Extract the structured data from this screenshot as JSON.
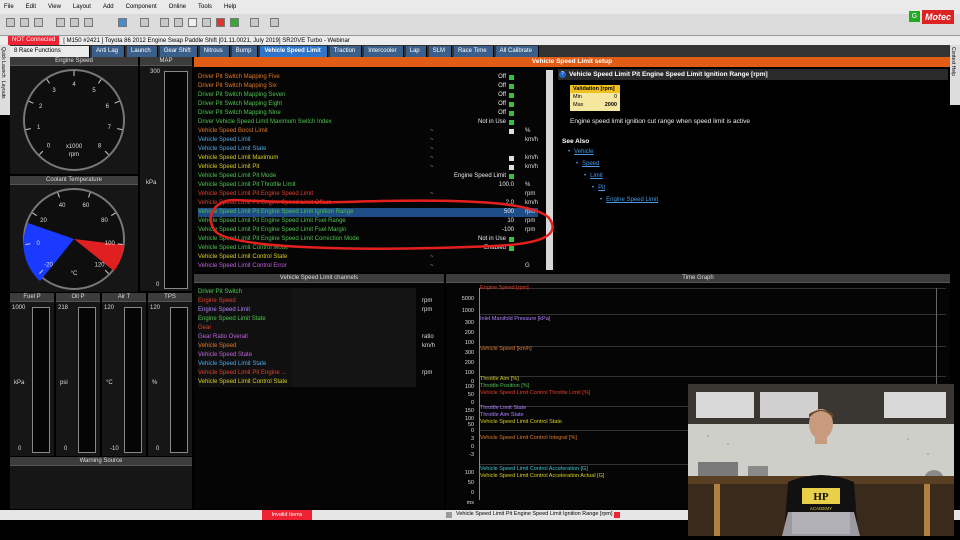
{
  "menu": [
    "File",
    "Edit",
    "View",
    "Layout",
    "Add",
    "Component",
    "Online",
    "Tools",
    "Help"
  ],
  "status_line": {
    "connection": "NOT Connected",
    "project": "[ M150 #2421 ]  Toyota 86 2012 Engine Swap Paddle Shift [01.11.0021, July 2019] SR20VE Turbo - Webinar"
  },
  "tabs": [
    "8 Race Functions",
    "Anti Lag",
    "Launch",
    "Gear Shift",
    "Nitrous",
    "Bump",
    "Vehicle Speed Limit",
    "Traction",
    "Intercooler",
    "Lap",
    "SLM",
    "Race Time",
    "All Calibrate"
  ],
  "active_tab": "Vehicle Speed Limit",
  "left_vtabs": [
    "Quick Launch",
    "Layouts"
  ],
  "right_vtabs": [
    "Context Help"
  ],
  "logo": "Motec",
  "setup_title": "Vehicle Speed Limit setup",
  "gauges": {
    "engine_speed": {
      "title": "Engine Speed",
      "ticks": [
        "0",
        "1",
        "2",
        "3",
        "4",
        "5",
        "6",
        "7",
        "8"
      ],
      "unit_top": "x1000",
      "unit": "rpm"
    },
    "map": {
      "title": "MAP",
      "top": "300",
      "unit": "kPa",
      "bottom": "0"
    },
    "coolant": {
      "title": "Coolant Temperature",
      "ticks": [
        "-20",
        "0",
        "20",
        "40",
        "60",
        "80",
        "100",
        "120"
      ],
      "unit": "°C"
    },
    "bars": [
      {
        "title": "Fuel P",
        "top": "1000",
        "unit": "kPa",
        "bottom": "0"
      },
      {
        "title": "Oil P",
        "top": "218",
        "unit": "psi",
        "bottom": "0"
      },
      {
        "title": "Air T",
        "top": "120",
        "unit": "°C",
        "bottom": "-10"
      },
      {
        "title": "TPS",
        "top": "120",
        "unit": "%",
        "bottom": "0"
      }
    ],
    "warning_title": "Warning Source"
  },
  "editor_rows": [
    {
      "name": "Driver Pit Switch Mapping Five",
      "color": "orange",
      "tilde": "",
      "val": "Off",
      "sw": "g",
      "unit": ""
    },
    {
      "name": "Driver Pit Switch Mapping Six",
      "color": "orange",
      "tilde": "",
      "val": "Off",
      "sw": "g",
      "unit": ""
    },
    {
      "name": "Driver Pit Switch Mapping Seven",
      "color": "green",
      "tilde": "",
      "val": "Off",
      "sw": "g",
      "unit": ""
    },
    {
      "name": "Driver Pit Switch Mapping Eight",
      "color": "green",
      "tilde": "",
      "val": "Off",
      "sw": "g",
      "unit": ""
    },
    {
      "name": "Driver Pit Switch Mapping Nine",
      "color": "green",
      "tilde": "",
      "val": "Off",
      "sw": "g",
      "unit": ""
    },
    {
      "name": "Driver Vehicle Speed Limit Maximum Switch Index",
      "color": "green",
      "tilde": "",
      "val": "Not in Use",
      "sw": "g",
      "unit": ""
    },
    {
      "name": "Vehicle Speed Boost Limit",
      "color": "orange",
      "tilde": "~",
      "val": "",
      "sw": "w",
      "unit": "%"
    },
    {
      "name": "Vehicle Speed Limit",
      "color": "blue",
      "tilde": "~",
      "val": "",
      "sw": "",
      "unit": "km/h"
    },
    {
      "name": "Vehicle Speed Limit State",
      "color": "blue",
      "tilde": "~",
      "val": "",
      "sw": "",
      "unit": ""
    },
    {
      "name": "Vehicle Speed Limit Maximum",
      "color": "yellow",
      "tilde": "~",
      "val": "",
      "sw": "w",
      "unit": "km/h"
    },
    {
      "name": "Vehicle Speed Limit Pit",
      "color": "yellow",
      "tilde": "~",
      "val": "",
      "sw": "w",
      "unit": "km/h"
    },
    {
      "name": "Vehicle Speed Limit Pit Mode",
      "color": "green",
      "tilde": "",
      "val": "Engine Speed Limit",
      "sw": "g",
      "unit": ""
    },
    {
      "name": "Vehicle Speed Limit Pit Throttle Limit",
      "color": "green",
      "tilde": "",
      "val": "100.0",
      "sw": "",
      "unit": "%"
    },
    {
      "name": "Vehicle Speed Limit Pit Engine Speed Limit",
      "color": "red",
      "tilde": "~",
      "val": "",
      "sw": "",
      "unit": "rpm"
    },
    {
      "name": "Vehicle Speed Limit Pit Engine Speed Limit Offset",
      "color": "red",
      "tilde": "",
      "val": "2.0",
      "sw": "",
      "unit": "km/h"
    },
    {
      "name": "Vehicle Speed Limit Pit Engine Speed Limit Ignition Range",
      "color": "green",
      "tilde": "",
      "val": "500",
      "sw": "",
      "unit": "rpm",
      "selected": true
    },
    {
      "name": "Vehicle Speed Limit Pit Engine Speed Limit Fuel Range",
      "color": "green",
      "tilde": "",
      "val": "10",
      "sw": "",
      "unit": "rpm"
    },
    {
      "name": "Vehicle Speed Limit Pit Engine Speed Limit Fuel Margin",
      "color": "green",
      "tilde": "",
      "val": "-100",
      "sw": "",
      "unit": "rpm"
    },
    {
      "name": "Vehicle Speed Limit Pit Engine Speed Limit Correction Mode",
      "color": "green",
      "tilde": "",
      "val": "Not in Use",
      "sw": "g",
      "unit": ""
    },
    {
      "name": "Vehicle Speed Limit Control Mode",
      "color": "green",
      "tilde": "",
      "val": "Enabled",
      "sw": "g",
      "unit": ""
    },
    {
      "name": "Vehicle Speed Limit Control State",
      "color": "yellow",
      "tilde": "~",
      "val": "",
      "sw": "",
      "unit": ""
    },
    {
      "name": "Vehicle Speed Limit Control Error",
      "color": "purple",
      "tilde": "~",
      "val": "",
      "sw": "",
      "unit": "G"
    }
  ],
  "help": {
    "title": "Vehicle Speed Limit Pit Engine Speed Limit Ignition Range [rpm]",
    "validation_title": "Validation [rpm]",
    "min_label": "Min",
    "min": "0",
    "max_label": "Max",
    "max": "2000",
    "description": "Engine speed limit ignition cut range when speed limit is active",
    "see_also_title": "See Also",
    "see_also": [
      "Vehicle",
      "Speed",
      "Limit",
      "Pit",
      "Engine Speed Limit"
    ]
  },
  "channels": {
    "title": "Vehicle Speed Limit channels",
    "rows": [
      {
        "name": "Driver Pit Switch",
        "color": "green",
        "unit": ""
      },
      {
        "name": "Engine Speed",
        "color": "red",
        "unit": "rpm"
      },
      {
        "name": "Engine Speed Limit",
        "color": "violet",
        "unit": "rpm"
      },
      {
        "name": "Engine Speed Limit State",
        "color": "green",
        "unit": ""
      },
      {
        "name": "Gear",
        "color": "red",
        "unit": ""
      },
      {
        "name": "Gear Ratio Overall",
        "color": "purple",
        "unit": "ratio"
      },
      {
        "name": "Vehicle Speed",
        "color": "orange",
        "unit": "km/h"
      },
      {
        "name": "Vehicle Speed State",
        "color": "purple",
        "unit": ""
      },
      {
        "name": "Vehicle Speed Limit State",
        "color": "blue",
        "unit": ""
      },
      {
        "name": "Vehicle Speed Limit Pit Engine ...",
        "color": "red",
        "unit": "rpm"
      },
      {
        "name": "Vehicle Speed Limit Control State",
        "color": "yellow",
        "unit": ""
      }
    ]
  },
  "time_graph": {
    "title": "Time Graph",
    "ticks": [
      "5000",
      "1000",
      "300",
      "200",
      "100",
      "300",
      "200",
      "100",
      "0",
      "100",
      "50",
      "0",
      "150",
      "100",
      "50",
      "0",
      "3",
      "0",
      "-3",
      "100",
      "50",
      "0",
      "ms"
    ],
    "labels": [
      {
        "text": "Engine Speed [rpm]",
        "color": "red"
      },
      {
        "text": "Inlet Manifold Pressure [kPa]",
        "color": "violet"
      },
      {
        "text": "Vehicle Speed [km/h]",
        "color": "orange"
      },
      {
        "text": "Throttle Aim [%]",
        "color": "yellow"
      },
      {
        "text": "Throttle Position [%]",
        "color": "green"
      },
      {
        "text": "Vehicle Speed Limit Control Throttle Limit [%]",
        "color": "red"
      },
      {
        "text": "Throttle Limit State",
        "color": "violet"
      },
      {
        "text": "Throttle Aim State",
        "color": "violet"
      },
      {
        "text": "Vehicle Speed Limit Control State",
        "color": "yellow"
      },
      {
        "text": "Vehicle Speed Limit Control Integral [%]",
        "color": "orange"
      },
      {
        "text": "Vehicle Speed Limit Control Acceleration [G]",
        "color": "cyan"
      },
      {
        "text": "Vehicle Speed Limit Control Acceleration Actual [G]",
        "color": "yellow"
      }
    ]
  },
  "status_bar": {
    "invalid": "Invalid Items",
    "selected": "Vehicle Speed Limit Pit Engine Speed Limit Ignition Range [rpm]"
  },
  "webcam": {
    "shirt_text": "HP",
    "shirt_sub": "ACADEMY"
  }
}
